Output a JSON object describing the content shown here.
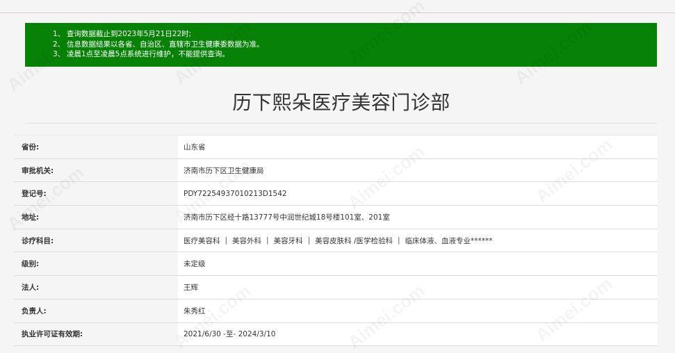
{
  "notice": {
    "lines": [
      {
        "num": "1、",
        "text": "查询数据截止到2023年5月21日22时;"
      },
      {
        "num": "2、",
        "text": "信息数据结果以各省、自治区、直辖市卫生健康委数据为准。"
      },
      {
        "num": "3、",
        "text": "凌晨1点至凌晨5点系统进行维护，不能提供查询。"
      }
    ],
    "color": "#078207"
  },
  "title": "历下熙朵医疗美容门诊部",
  "fields": [
    {
      "label": "省份:",
      "value": "山东省"
    },
    {
      "label": "审批机关:",
      "value": "济南市历下区卫生健康局"
    },
    {
      "label": "登记号:",
      "value": "PDY72254937010213D1542"
    },
    {
      "label": "地址:",
      "value": "济南市历下区经十路13777号中润世纪城18号楼101室、201室"
    },
    {
      "label": "诊疗科目:",
      "departments": [
        "医疗美容科",
        "美容外科",
        "美容牙科",
        "美容皮肤科 /医学检验科",
        "临床体液、血液专业******"
      ],
      "separator": "|"
    },
    {
      "label": "级别:",
      "value": "未定级"
    },
    {
      "label": "法人:",
      "value": "王辉"
    },
    {
      "label": "负责人:",
      "value": "朱秀红"
    },
    {
      "label": "执业许可证有效期:",
      "value": "2021/6/30 -至- 2024/3/10"
    }
  ],
  "watermark": {
    "text": "Aimei.com"
  }
}
